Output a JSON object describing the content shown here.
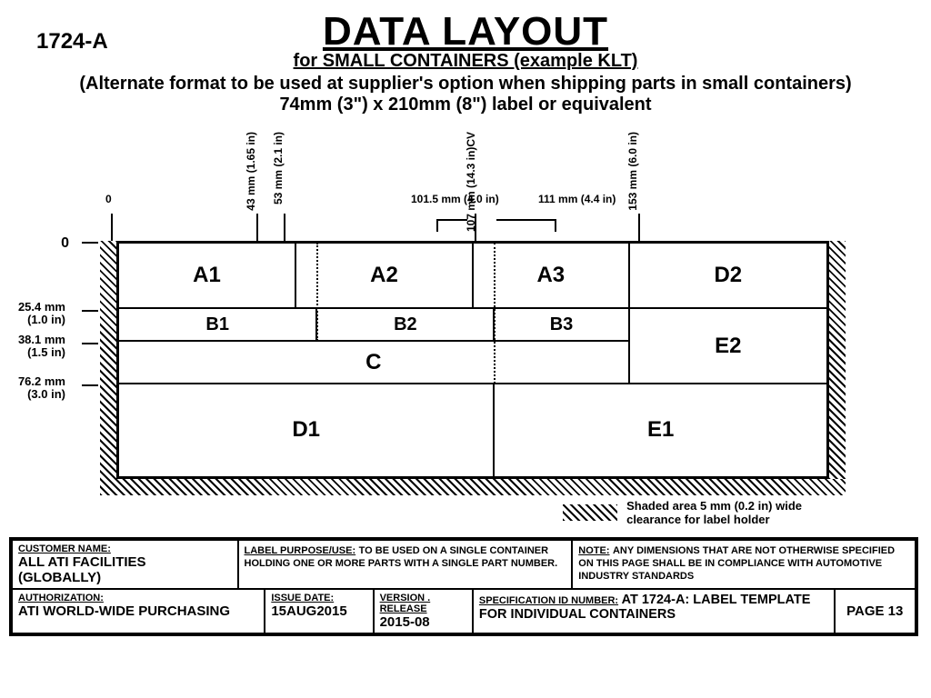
{
  "doc_id": "1724-A",
  "title": {
    "main": "DATA LAYOUT",
    "sub": "for SMALL CONTAINERS (example KLT)",
    "note": "(Alternate format to be used at supplier's option when shipping parts in small containers)",
    "dim": "74mm (3\") x 210mm (8\") label or equivalent"
  },
  "cells": {
    "A1": "A1",
    "A2": "A2",
    "A3": "A3",
    "D2": "D2",
    "B1": "B1",
    "B2": "B2",
    "B3": "B3",
    "E2": "E2",
    "C": "C",
    "D1": "D1",
    "E1": "E1"
  },
  "left_ticks": {
    "zero": "0",
    "t1": "25.4 mm\n(1.0 in)",
    "t2": "38.1 mm\n(1.5 in)",
    "t3": "76.2 mm\n(3.0 in)"
  },
  "top_ticks": {
    "zero": "0",
    "t43": "43 mm\n(1.65 in)",
    "t53": "53 mm\n(2.1 in)",
    "t101": "101.5 mm\n(4.0 in)",
    "t107": "107 mm\n(14.3 in)CV",
    "t111": "111 mm\n(4.4 in)",
    "t153": "153 mm\n(6.0 in)"
  },
  "legend": "Shaded area 5 mm (0.2 in) wide\nclearance for label holder",
  "footer": {
    "customer_label": "CUSTOMER NAME:",
    "customer": "ALL ATI FACILITIES (GLOBALLY)",
    "purpose_label": "LABEL PURPOSE/USE:",
    "purpose": "TO BE USED ON A SINGLE CONTAINER HOLDING ONE OR MORE PARTS WITH A SINGLE PART NUMBER.",
    "note_label": "NOTE:",
    "note": "ANY DIMENSIONS THAT ARE NOT OTHERWISE SPECIFIED ON THIS PAGE SHALL BE IN COMPLIANCE WITH AUTOMOTIVE INDUSTRY STANDARDS",
    "auth_label": "AUTHORIZATION:",
    "auth": "ATI WORLD-WIDE PURCHASING",
    "issue_label": "ISSUE DATE:",
    "issue": "15AUG2015",
    "ver_label": "VERSION . RELEASE",
    "ver": "2015-08",
    "spec_label": "SPECIFICATION ID NUMBER:",
    "spec": "AT 1724-A:  LABEL TEMPLATE FOR INDIVIDUAL CONTAINERS",
    "page": "PAGE 13"
  }
}
